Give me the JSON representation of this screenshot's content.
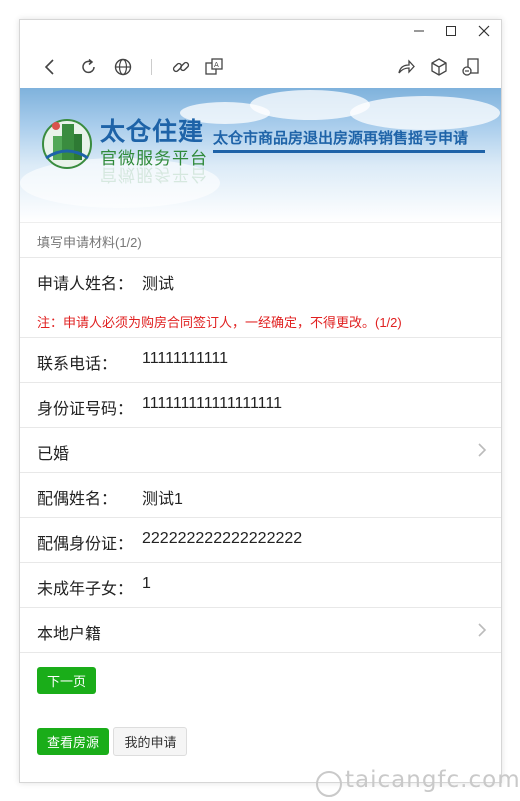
{
  "window": {
    "minimize_icon": "minimize-icon",
    "maximize_icon": "maximize-icon",
    "close_icon": "close-icon"
  },
  "toolbar": {
    "icons": [
      "back-icon",
      "refresh-icon",
      "globe-icon",
      "link-icon",
      "translate-icon",
      "share-icon",
      "cube-icon",
      "pin-window-icon"
    ]
  },
  "banner": {
    "brand_title": "太仓住建",
    "brand_sub": "官微服务平台",
    "page_title": "太仓市商品房退出房源再销售摇号申请"
  },
  "form": {
    "section_title": "填写申请材料(1/2)",
    "applicant_label": "申请人姓名：",
    "applicant_value": "测试",
    "note": "注：申请人必须为购房合同签订人，一经确定，不得更改。(1/2)",
    "phone_label": "联系电话：",
    "phone_value": "11111111111",
    "id_label": "身份证号码：",
    "id_value": "111111111111111111",
    "marital_status": "已婚",
    "spouse_name_label": "配偶姓名：",
    "spouse_name_value": "测试1",
    "spouse_id_label": "配偶身份证：",
    "spouse_id_value": "222222222222222222",
    "minors_label": "未成年子女：",
    "minors_value": "1",
    "household": "本地户籍"
  },
  "buttons": {
    "next": "下一页",
    "view_listings": "查看房源",
    "my_applications": "我的申请"
  },
  "colors": {
    "accent_green": "#1aad19",
    "brand_blue": "#1e63a8",
    "note_red": "#e02020"
  },
  "watermark": "taicangfc.com"
}
